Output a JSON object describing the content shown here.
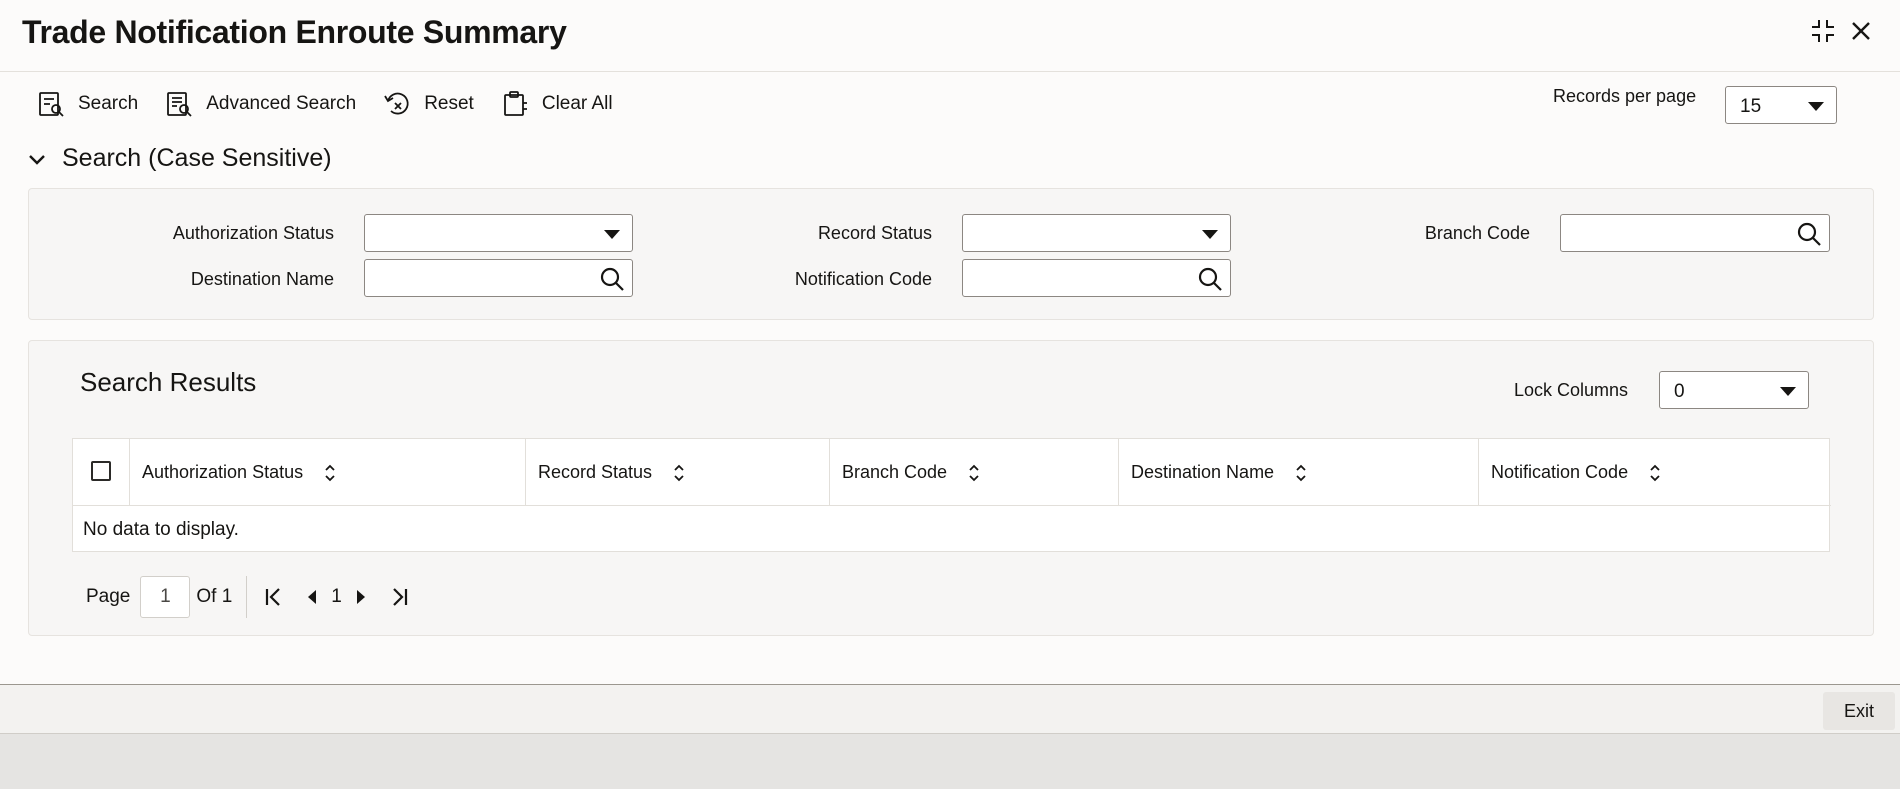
{
  "header": {
    "title": "Trade Notification Enroute Summary",
    "icons": {
      "minimize": "collapse-icon",
      "close": "close-icon"
    }
  },
  "toolbar": {
    "search_label": "Search",
    "advanced_search_label": "Advanced Search",
    "reset_label": "Reset",
    "clear_all_label": "Clear All",
    "records_per_page_label": "Records per page",
    "records_per_page_value": "15"
  },
  "search_section": {
    "title": "Search (Case Sensitive)",
    "fields": {
      "authorization_status": {
        "label": "Authorization Status",
        "value": ""
      },
      "record_status": {
        "label": "Record Status",
        "value": ""
      },
      "branch_code": {
        "label": "Branch Code",
        "value": ""
      },
      "destination_name": {
        "label": "Destination Name",
        "value": ""
      },
      "notification_code": {
        "label": "Notification Code",
        "value": ""
      }
    }
  },
  "results": {
    "title": "Search Results",
    "lock_columns_label": "Lock Columns",
    "lock_columns_value": "0",
    "columns": [
      "Authorization Status",
      "Record Status",
      "Branch Code",
      "Destination Name",
      "Notification Code"
    ],
    "rows": [],
    "empty_message": "No data to display.",
    "pager": {
      "page_label": "Page",
      "page_value": "1",
      "of_label": "Of 1",
      "current_page": "1"
    }
  },
  "footer": {
    "exit_label": "Exit"
  },
  "colors": {
    "background": "#fcfbfa",
    "panel": "#f7f6f5",
    "text": "#161513",
    "border": "#8c8782"
  }
}
